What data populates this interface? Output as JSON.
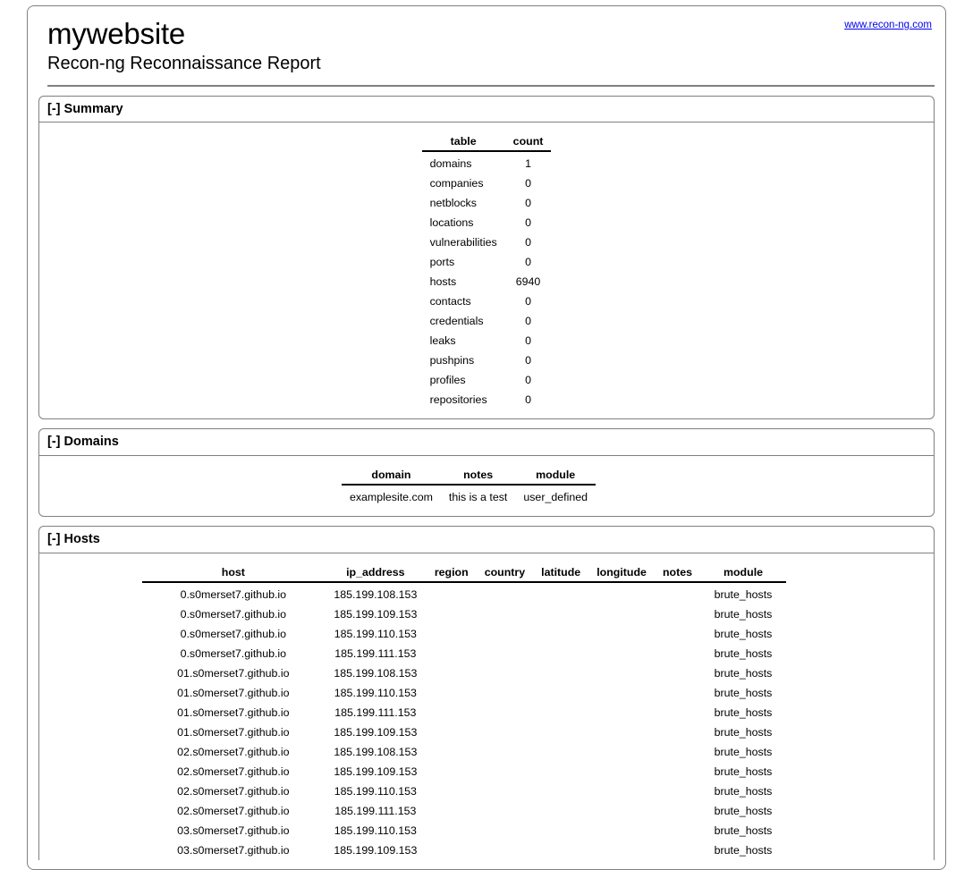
{
  "header": {
    "site_title": "mywebsite",
    "subtitle": "Recon-ng Reconnaissance Report",
    "link_text": "www.recon-ng.com",
    "link_color": "#0000ee"
  },
  "sections": {
    "summary": {
      "toggle": "[-]",
      "title": "Summary",
      "columns": [
        "table",
        "count"
      ],
      "rows": [
        [
          "domains",
          "1"
        ],
        [
          "companies",
          "0"
        ],
        [
          "netblocks",
          "0"
        ],
        [
          "locations",
          "0"
        ],
        [
          "vulnerabilities",
          "0"
        ],
        [
          "ports",
          "0"
        ],
        [
          "hosts",
          "6940"
        ],
        [
          "contacts",
          "0"
        ],
        [
          "credentials",
          "0"
        ],
        [
          "leaks",
          "0"
        ],
        [
          "pushpins",
          "0"
        ],
        [
          "profiles",
          "0"
        ],
        [
          "repositories",
          "0"
        ]
      ]
    },
    "domains": {
      "toggle": "[-]",
      "title": "Domains",
      "columns": [
        "domain",
        "notes",
        "module"
      ],
      "rows": [
        [
          "examplesite.com",
          "this is a test",
          "user_defined"
        ]
      ]
    },
    "hosts": {
      "toggle": "[-]",
      "title": "Hosts",
      "columns": [
        "host",
        "ip_address",
        "region",
        "country",
        "latitude",
        "longitude",
        "notes",
        "module"
      ],
      "rows": [
        [
          "0.s0merset7.github.io",
          "185.199.108.153",
          "",
          "",
          "",
          "",
          "",
          "brute_hosts"
        ],
        [
          "0.s0merset7.github.io",
          "185.199.109.153",
          "",
          "",
          "",
          "",
          "",
          "brute_hosts"
        ],
        [
          "0.s0merset7.github.io",
          "185.199.110.153",
          "",
          "",
          "",
          "",
          "",
          "brute_hosts"
        ],
        [
          "0.s0merset7.github.io",
          "185.199.111.153",
          "",
          "",
          "",
          "",
          "",
          "brute_hosts"
        ],
        [
          "01.s0merset7.github.io",
          "185.199.108.153",
          "",
          "",
          "",
          "",
          "",
          "brute_hosts"
        ],
        [
          "01.s0merset7.github.io",
          "185.199.110.153",
          "",
          "",
          "",
          "",
          "",
          "brute_hosts"
        ],
        [
          "01.s0merset7.github.io",
          "185.199.111.153",
          "",
          "",
          "",
          "",
          "",
          "brute_hosts"
        ],
        [
          "01.s0merset7.github.io",
          "185.199.109.153",
          "",
          "",
          "",
          "",
          "",
          "brute_hosts"
        ],
        [
          "02.s0merset7.github.io",
          "185.199.108.153",
          "",
          "",
          "",
          "",
          "",
          "brute_hosts"
        ],
        [
          "02.s0merset7.github.io",
          "185.199.109.153",
          "",
          "",
          "",
          "",
          "",
          "brute_hosts"
        ],
        [
          "02.s0merset7.github.io",
          "185.199.110.153",
          "",
          "",
          "",
          "",
          "",
          "brute_hosts"
        ],
        [
          "02.s0merset7.github.io",
          "185.199.111.153",
          "",
          "",
          "",
          "",
          "",
          "brute_hosts"
        ],
        [
          "03.s0merset7.github.io",
          "185.199.110.153",
          "",
          "",
          "",
          "",
          "",
          "brute_hosts"
        ],
        [
          "03.s0merset7.github.io",
          "185.199.109.153",
          "",
          "",
          "",
          "",
          "",
          "brute_hosts"
        ]
      ]
    }
  }
}
